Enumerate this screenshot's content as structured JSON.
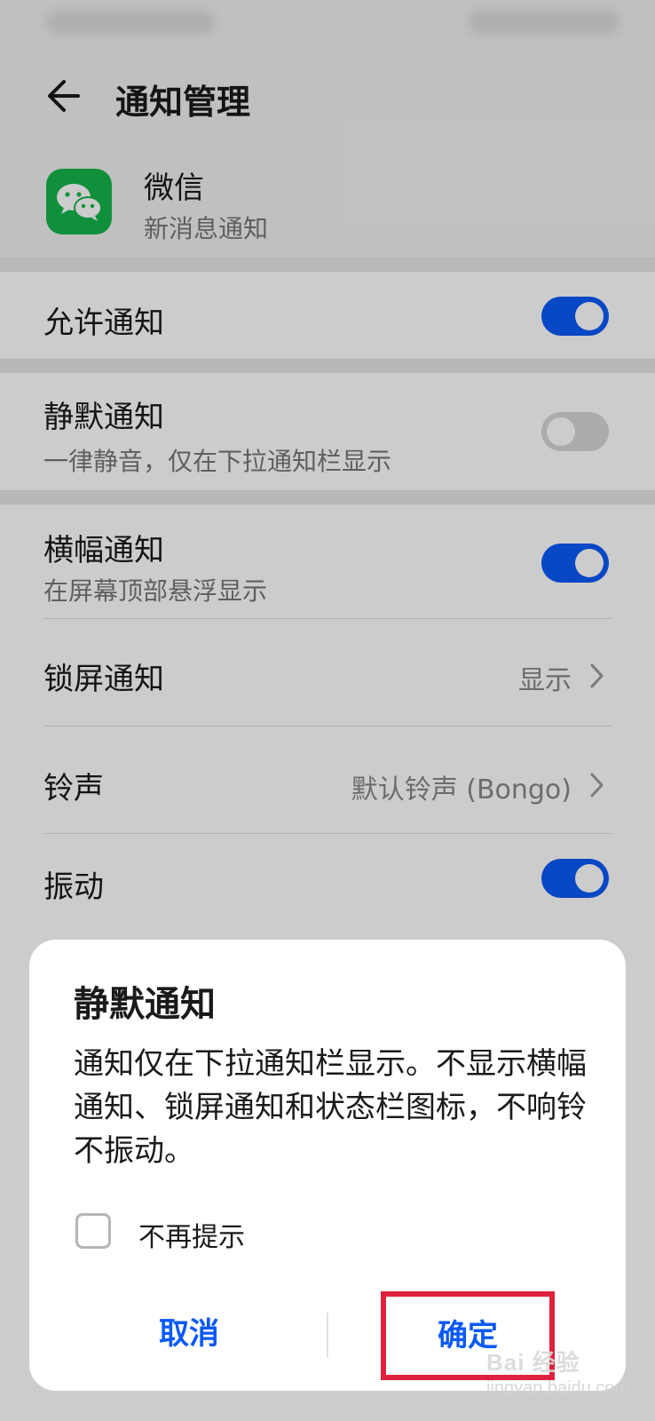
{
  "header": {
    "title": "通知管理"
  },
  "app": {
    "name": "微信",
    "subtitle": "新消息通知"
  },
  "settings": {
    "allow": {
      "label": "允许通知",
      "enabled": true
    },
    "silent": {
      "label": "静默通知",
      "description": "一律静音，仅在下拉通知栏显示",
      "enabled": false
    },
    "banner": {
      "label": "横幅通知",
      "description": "在屏幕顶部悬浮显示",
      "enabled": true
    },
    "lockscreen": {
      "label": "锁屏通知",
      "value": "显示"
    },
    "ringtone": {
      "label": "铃声",
      "value": "默认铃声 (Bongo)"
    },
    "vibrate": {
      "label": "振动",
      "enabled": true
    }
  },
  "dialog": {
    "title": "静默通知",
    "message": "通知仅在下拉通知栏显示。不显示横幅通知、锁屏通知和状态栏图标，不响铃不振动。",
    "checkbox_label": "不再提示",
    "checkbox_checked": false,
    "cancel_label": "取消",
    "confirm_label": "确定"
  },
  "watermark": {
    "text": "Bai 经验",
    "url": "jingyan.baidu.com"
  },
  "colors": {
    "accent": "#0a59f7",
    "highlight_box": "#e0213e",
    "app_icon": "#16b44a"
  }
}
